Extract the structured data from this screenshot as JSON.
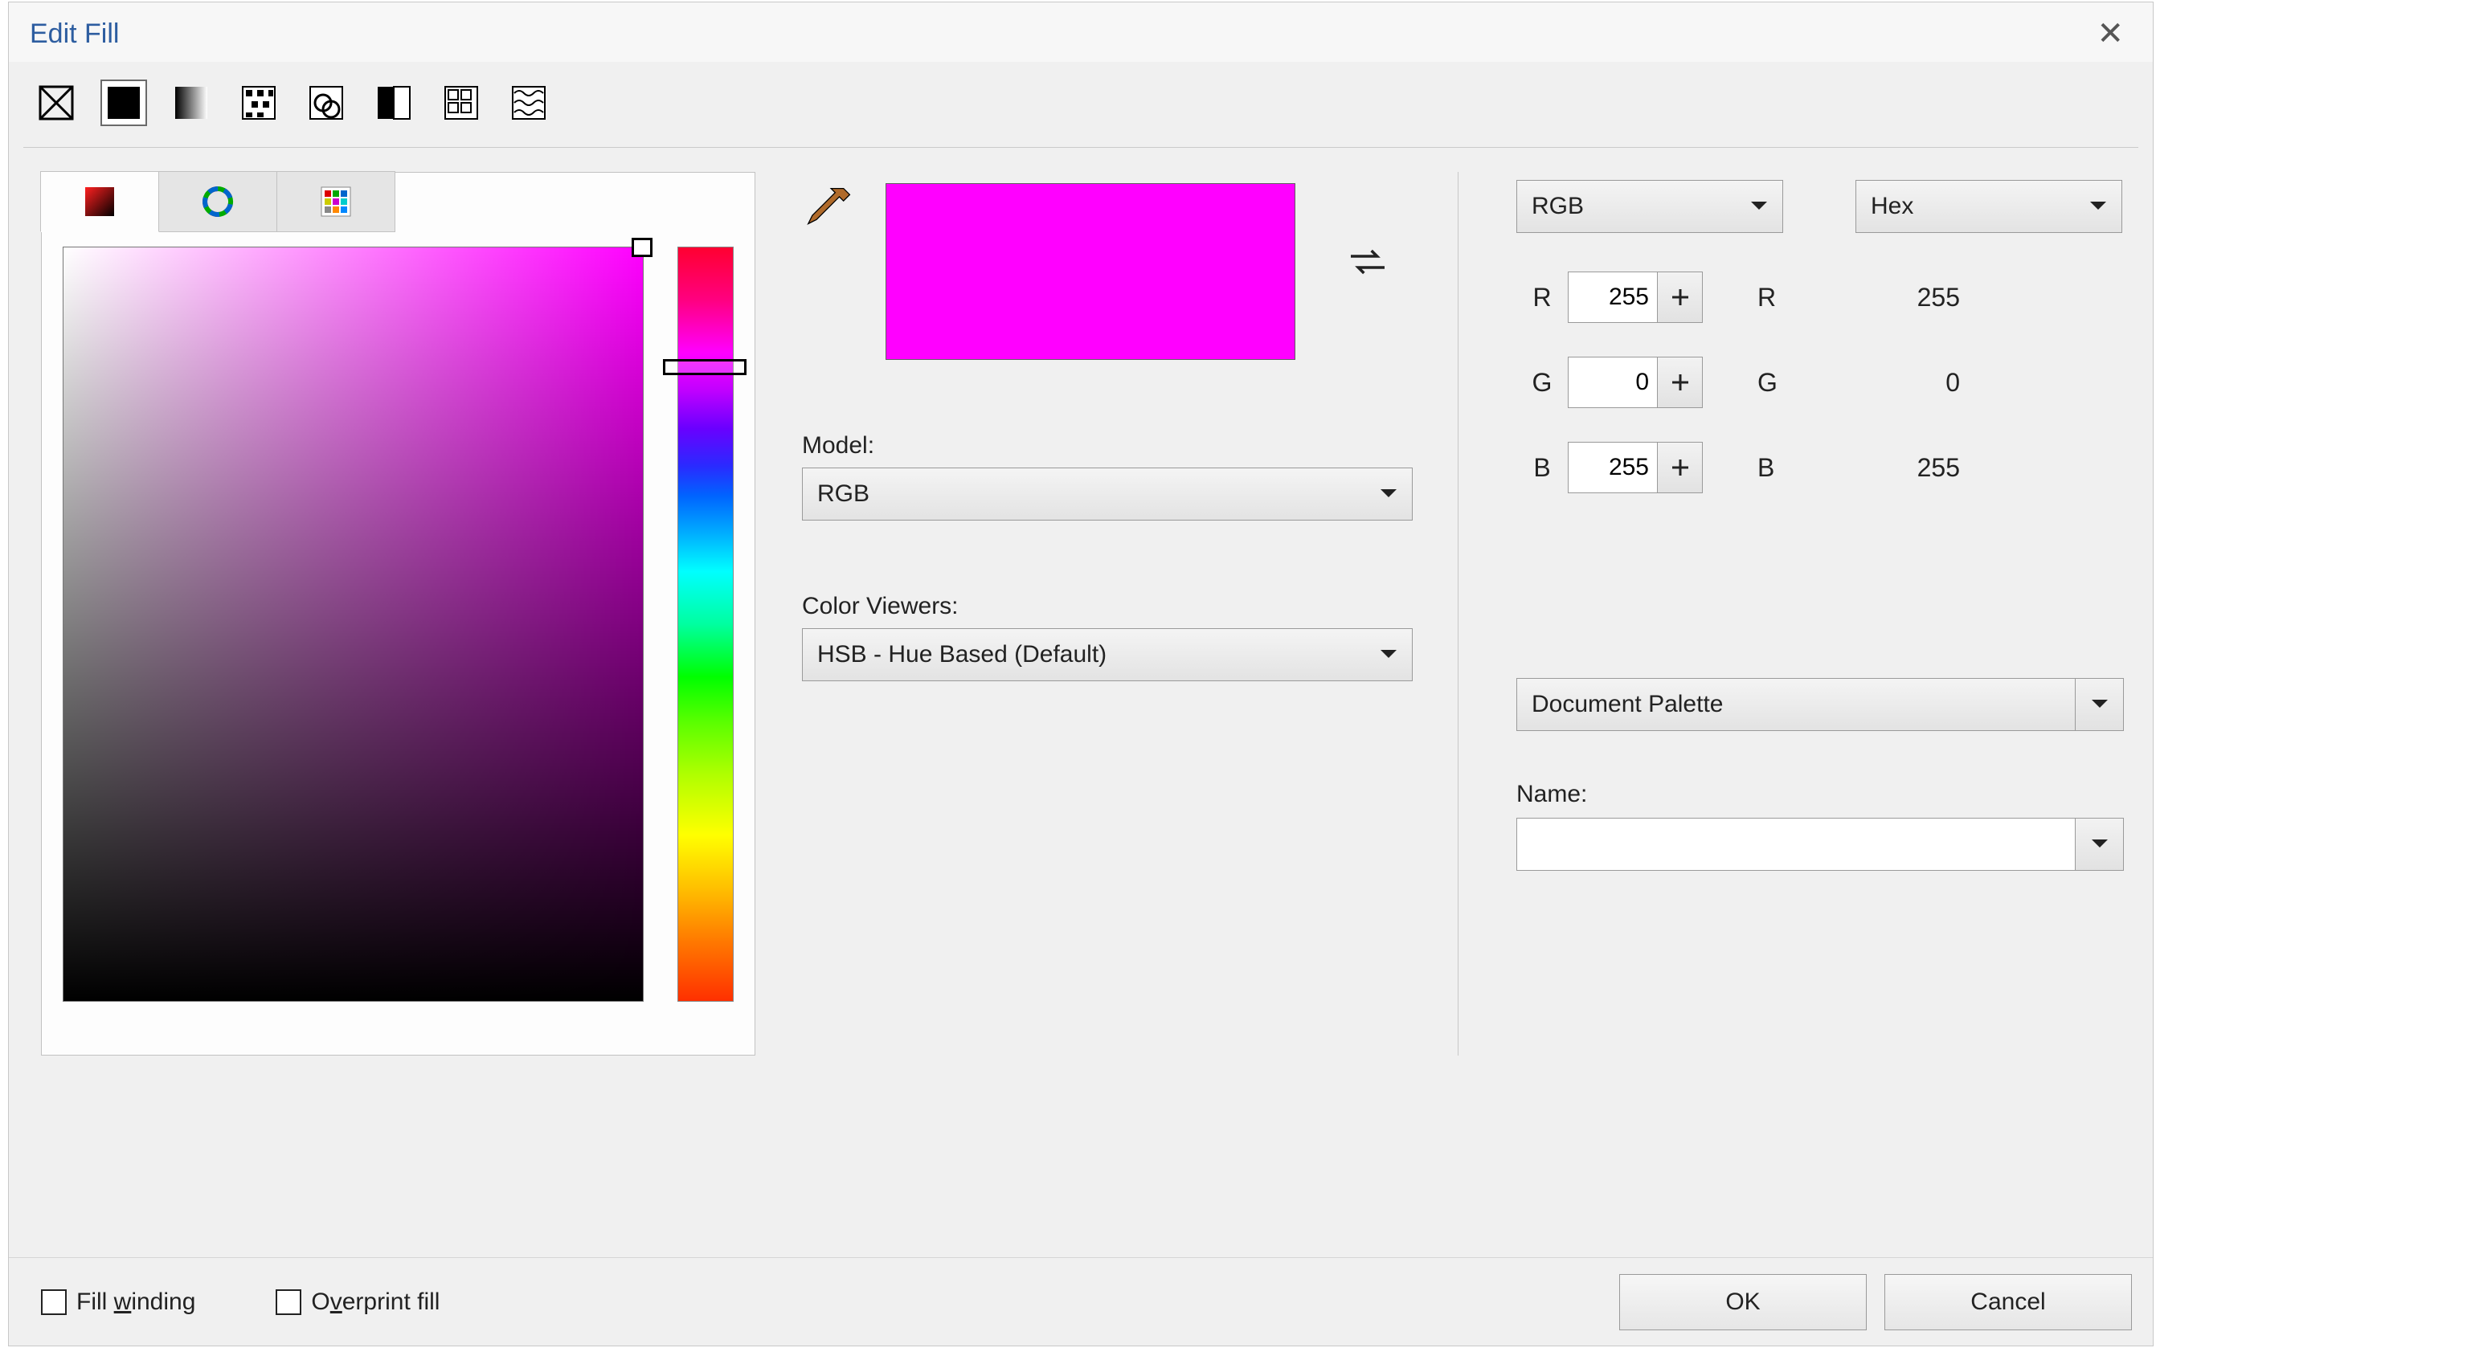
{
  "dialog": {
    "title": "Edit Fill"
  },
  "fill_tabs": [
    {
      "name": "no-fill"
    },
    {
      "name": "uniform-fill"
    },
    {
      "name": "fountain-fill"
    },
    {
      "name": "vector-pattern"
    },
    {
      "name": "bitmap-pattern"
    },
    {
      "name": "two-color-pattern"
    },
    {
      "name": "texture-fill"
    },
    {
      "name": "postscript-fill"
    }
  ],
  "fill_tabs_selected_index": 1,
  "viewer_tabs_selected_index": 0,
  "swatch_color": "#FF00FF",
  "model": {
    "label": "Model:",
    "value": "RGB"
  },
  "color_viewers": {
    "label": "Color Viewers:",
    "value": "HSB - Hue Based (Default)"
  },
  "right": {
    "model_dd": "RGB",
    "hex_dd": "Hex",
    "channels": [
      "R",
      "G",
      "B"
    ],
    "values": [
      255,
      0,
      255
    ],
    "hex_values": [
      255,
      0,
      255
    ]
  },
  "palette": {
    "value": "Document Palette"
  },
  "name": {
    "label": "Name:",
    "value": ""
  },
  "footer": {
    "fill_winding": "Fill winding",
    "overprint": "Overprint fill",
    "ok": "OK",
    "cancel": "Cancel"
  }
}
